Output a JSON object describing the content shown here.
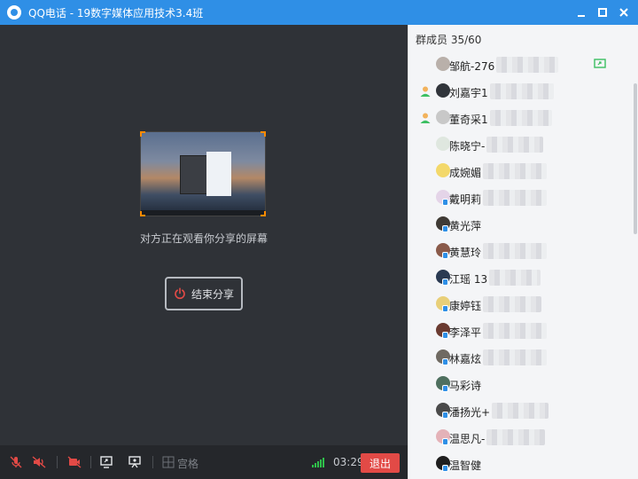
{
  "window": {
    "title": "QQ电话 - 19数字媒体应用技术3.4班"
  },
  "share": {
    "status_text": "对方正在观看你分享的屏幕",
    "end_share_label": "结束分享"
  },
  "toolbar": {
    "grid_label": "宫格",
    "timer": "03:29",
    "exit_label": "退出"
  },
  "members_panel": {
    "header": "群成员 35/60",
    "members": [
      {
        "name": "邹航-276",
        "role": false,
        "avatar_color": "#b9b0aa",
        "blur_width": 70,
        "sharing": true
      },
      {
        "name": "刘嘉宇1",
        "role": true,
        "avatar_color": "#30343a",
        "blur_width": 72,
        "sharing": false
      },
      {
        "name": "董奇采1",
        "role": true,
        "avatar_color": "#c8c8c8",
        "blur_width": 70,
        "sharing": false
      },
      {
        "name": "陈晓宁-",
        "role": false,
        "avatar_color": "#dfe7df",
        "blur_width": 64,
        "sharing": false
      },
      {
        "name": "成婉媚",
        "role": false,
        "avatar_color": "#f3d86a",
        "blur_width": 72,
        "sharing": false
      },
      {
        "name": "戴明莉",
        "role": false,
        "avatar_color": "#e4d4e8",
        "blur_width": 72,
        "sharing": false
      },
      {
        "name": "黄光萍",
        "role": false,
        "avatar_color": "#3f3a34",
        "blur_width": 0,
        "sharing": false
      },
      {
        "name": "黄慧玲",
        "role": false,
        "avatar_color": "#8a5a4a",
        "blur_width": 72,
        "sharing": false
      },
      {
        "name": "江瑶 13",
        "role": false,
        "avatar_color": "#2a3a52",
        "blur_width": 58,
        "sharing": false
      },
      {
        "name": "康婷钰",
        "role": false,
        "avatar_color": "#e8cf78",
        "blur_width": 66,
        "sharing": false
      },
      {
        "name": "李泽平",
        "role": false,
        "avatar_color": "#6a3a30",
        "blur_width": 72,
        "sharing": false
      },
      {
        "name": "林嘉炫",
        "role": false,
        "avatar_color": "#6f6a62",
        "blur_width": 72,
        "sharing": false
      },
      {
        "name": "马彩诗",
        "role": false,
        "avatar_color": "#4e6f5e",
        "blur_width": 0,
        "sharing": false
      },
      {
        "name": "潘扬光+",
        "role": false,
        "avatar_color": "#4a4a4a",
        "blur_width": 64,
        "sharing": false
      },
      {
        "name": "温思凡-",
        "role": false,
        "avatar_color": "#e4b2b8",
        "blur_width": 66,
        "sharing": false
      },
      {
        "name": "温智健",
        "role": false,
        "avatar_color": "#1e1e1e",
        "blur_width": 0,
        "sharing": false
      }
    ]
  }
}
